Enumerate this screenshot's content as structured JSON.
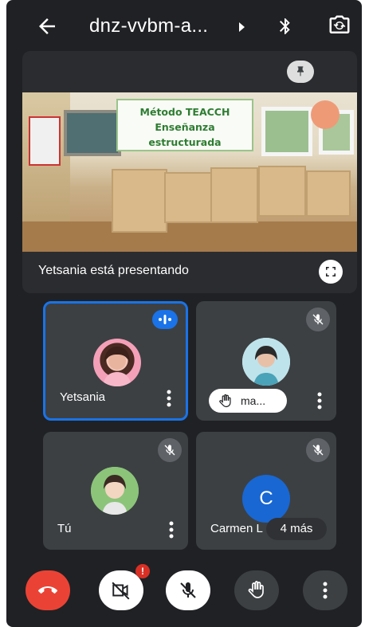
{
  "header": {
    "meeting_code": "dnz-vvbm-a...",
    "icons": [
      "back-arrow-icon",
      "dropdown-triangle-icon",
      "bluetooth-icon",
      "switch-camera-icon"
    ]
  },
  "presentation": {
    "slide_title_line1": "Método TEACCH",
    "slide_title_line2": "Enseñanza",
    "slide_title_line3": "estructurada",
    "caption": "Yetsania está presentando",
    "icons": [
      "pin-icon",
      "fullscreen-icon"
    ]
  },
  "participants": [
    {
      "name": "Yetsania",
      "status": "speaking",
      "active": true
    },
    {
      "name": "ma...",
      "status": "muted",
      "hand_raised": true
    },
    {
      "name": "Tú",
      "status": "muted"
    },
    {
      "name": "Carmen L",
      "initial": "C",
      "status": "muted",
      "more_label": "4 más"
    }
  ],
  "controls": {
    "camera_badge": "!",
    "buttons": [
      "end-call",
      "camera-off",
      "mic-off",
      "raise-hand",
      "more-options"
    ]
  },
  "colors": {
    "background": "#202124",
    "tile": "#3c4043",
    "accent": "#1a73e8",
    "end_call": "#ea4335",
    "badge": "#d93025"
  }
}
